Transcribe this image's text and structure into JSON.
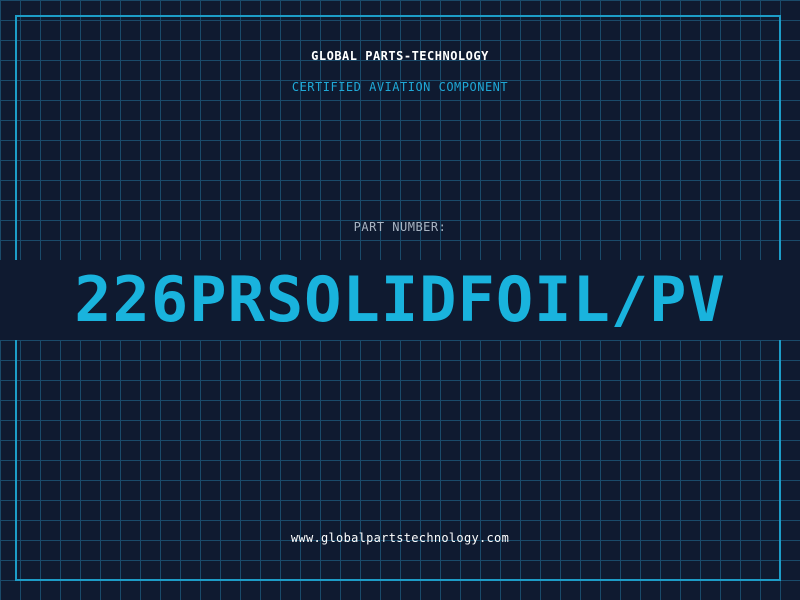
{
  "header": {
    "company_name": "GLOBAL PARTS-TECHNOLOGY",
    "tagline": "CERTIFIED AVIATION COMPONENT"
  },
  "part": {
    "label": "PART NUMBER:",
    "number": "226PRSOLIDFOIL/PV"
  },
  "footer": {
    "website": "www.globalpartstechnology.com"
  },
  "colors": {
    "background": "#0f1a30",
    "grid": "#1a4a6a",
    "accent": "#19b3dd",
    "frame": "#1d9cc7",
    "label": "#a9b4c2",
    "text": "#ffffff"
  }
}
